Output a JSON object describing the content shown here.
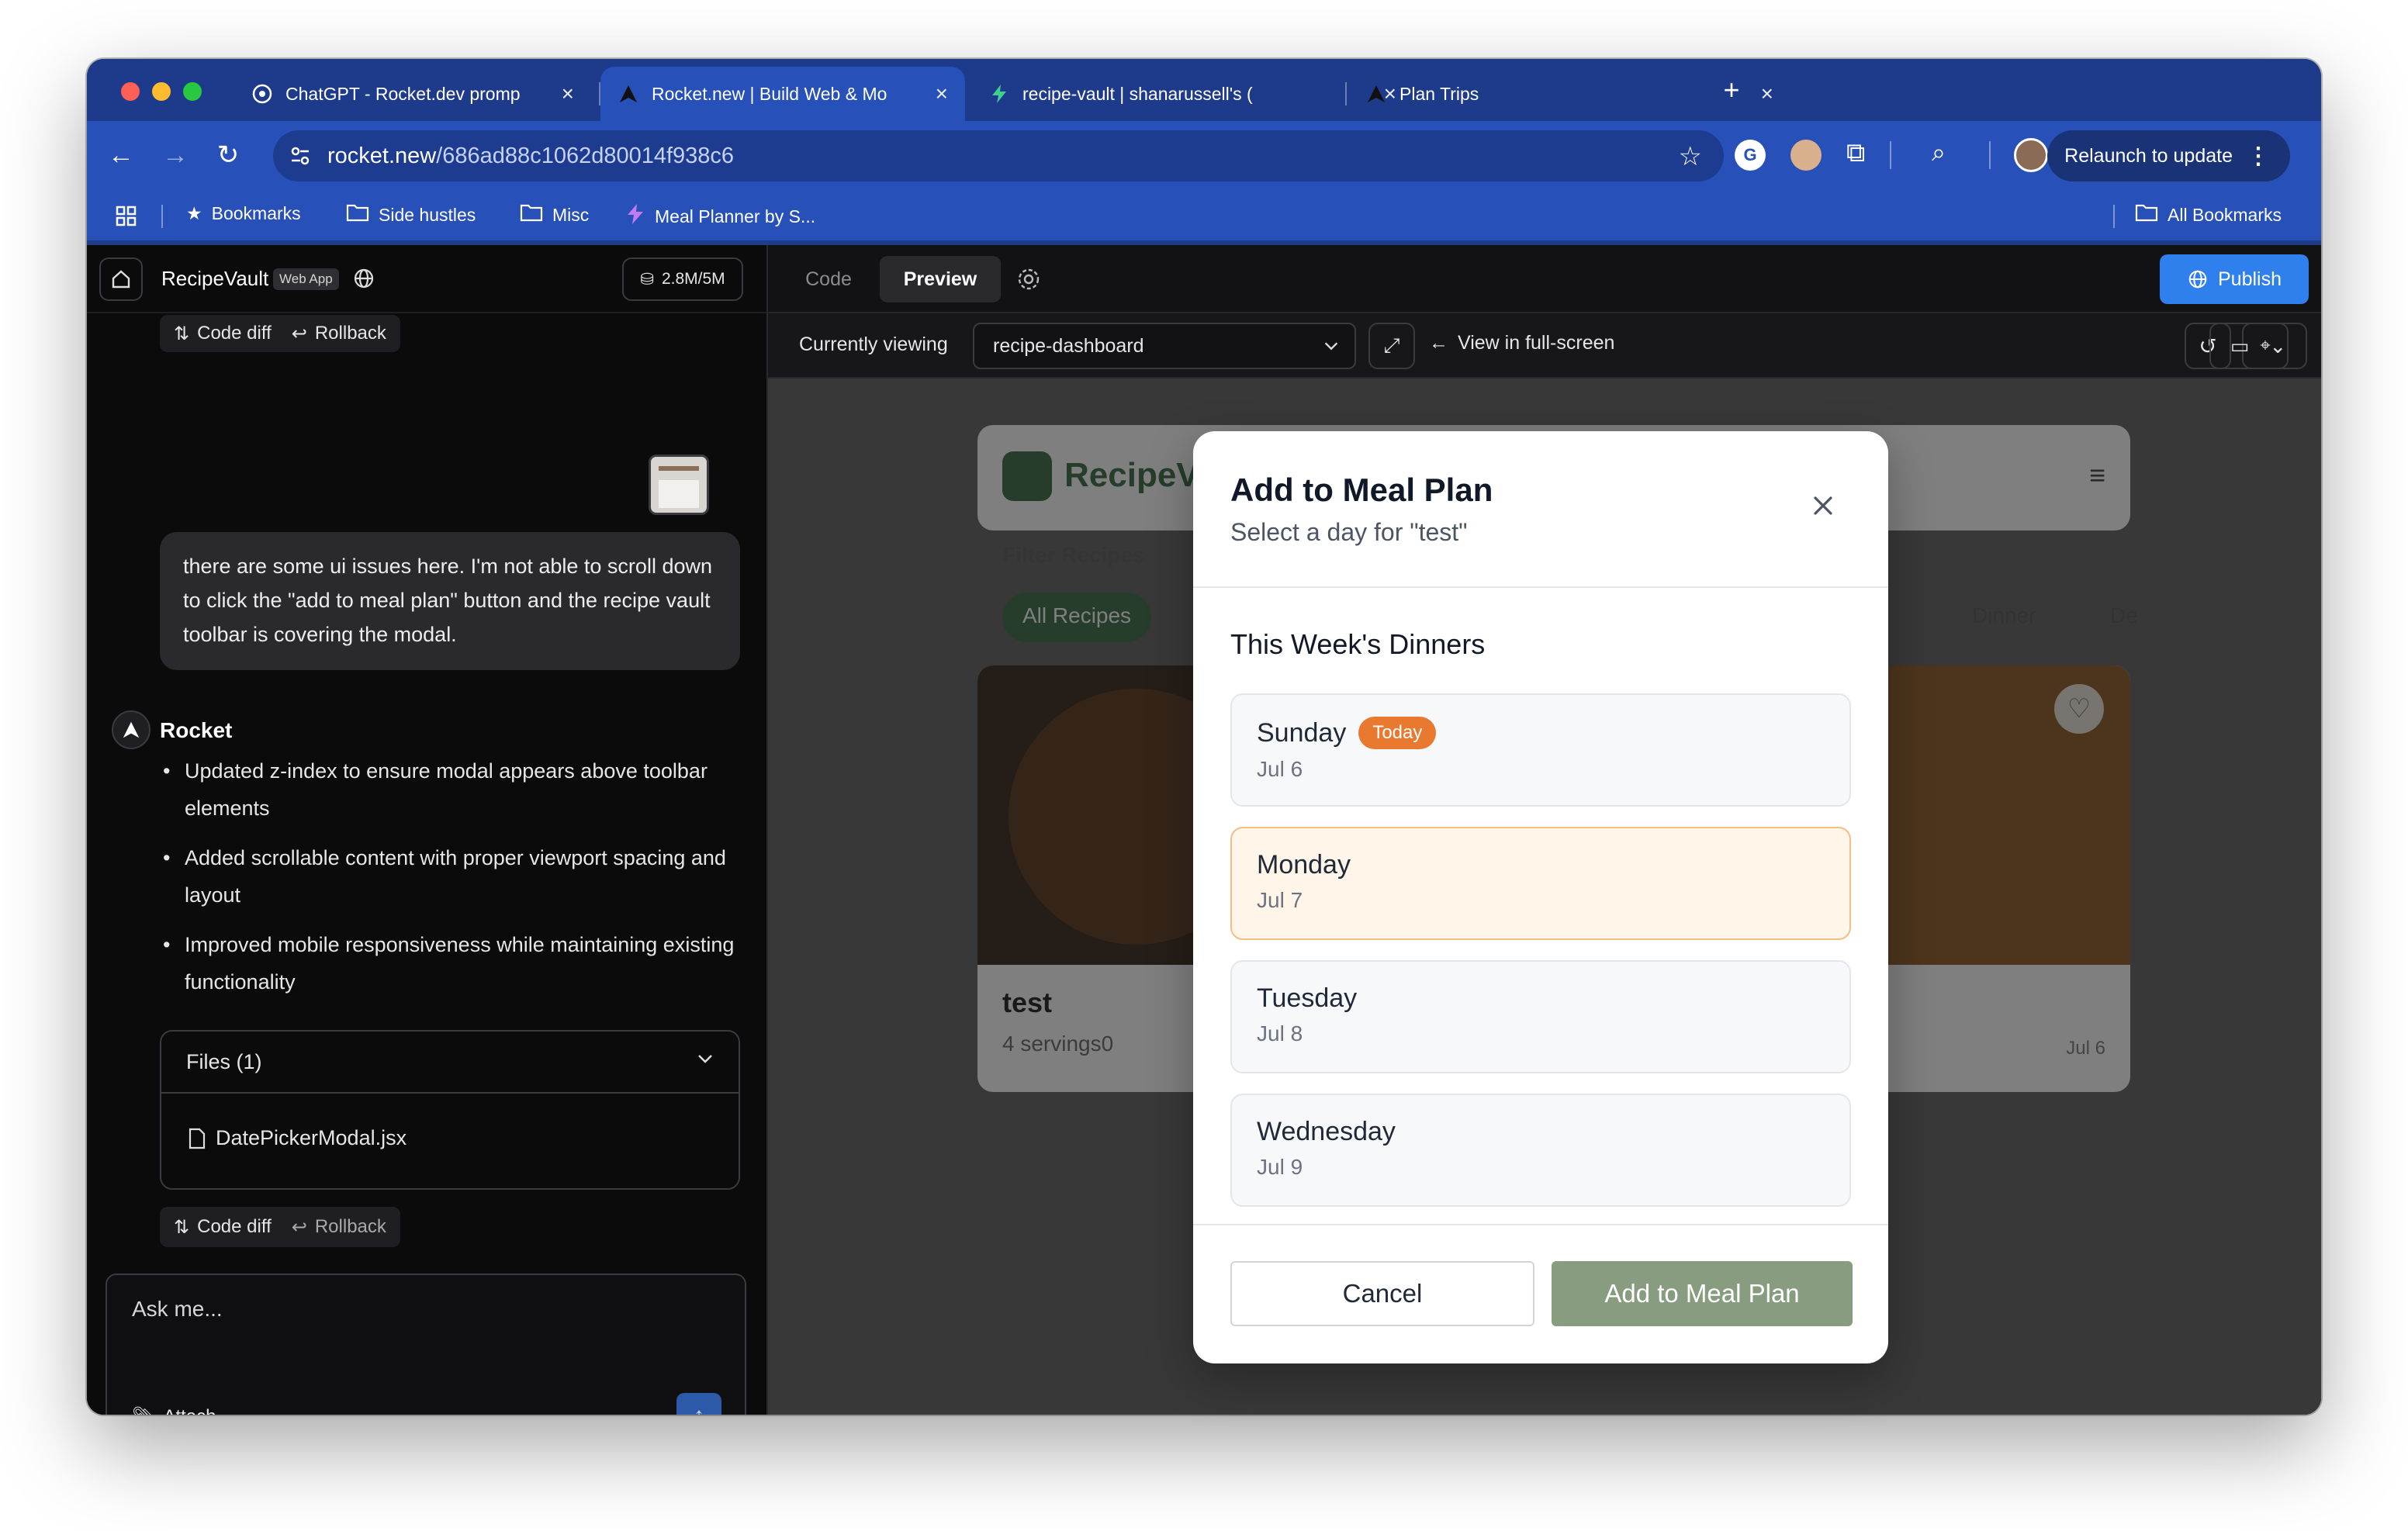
{
  "browser": {
    "tabs": [
      {
        "title": "ChatGPT - Rocket.dev promp",
        "favicon": "chatgpt-icon"
      },
      {
        "title": "Rocket.new | Build Web & Mo",
        "favicon": "rocket-icon",
        "active": true
      },
      {
        "title": "recipe-vault | shanarussell's (",
        "favicon": "bolt-icon"
      },
      {
        "title": "Plan Trips",
        "favicon": "rocket-icon"
      }
    ],
    "url_host": "rocket.new",
    "url_path": "/686ad88c1062d80014f938c6",
    "relaunch_label": "Relaunch to update",
    "bookmarks": [
      {
        "label": "Bookmarks",
        "icon": "star-icon"
      },
      {
        "label": "Side hustles",
        "icon": "folder-icon"
      },
      {
        "label": "Misc",
        "icon": "folder-icon"
      },
      {
        "label": "Meal Planner by S...",
        "icon": "bolt-icon"
      }
    ],
    "all_bookmarks_label": "All Bookmarks"
  },
  "left_panel": {
    "project_name": "RecipeVault",
    "project_badge": "Web App",
    "token_usage": "2.8M/5M",
    "code_diff_label": "Code diff",
    "rollback_label": "Rollback",
    "user_message": "there are some ui issues here. I'm not able to scroll down to click the \"add to meal plan\" button and the recipe vault toolbar is covering the modal.",
    "assistant_name": "Rocket",
    "assistant_bullets": [
      "Updated z-index to ensure modal appears above toolbar elements",
      "Added scrollable content with proper viewport spacing and layout",
      "Improved mobile responsiveness while maintaining existing functionality"
    ],
    "files_label": "Files (1)",
    "file_name": "DatePickerModal.jsx",
    "input_placeholder": "Ask me...",
    "attach_label": "Attach"
  },
  "right_panel": {
    "tabs": [
      "Code",
      "Preview"
    ],
    "active_tab": "Preview",
    "publish_label": "Publish",
    "currently_viewing_label": "Currently viewing",
    "viewing_value": "recipe-dashboard",
    "fullscreen_label": "View in full-screen"
  },
  "app_preview": {
    "brand": "RecipeVa",
    "filter_label": "Filter Recipes",
    "all_recipes_label": "All Recipes",
    "dinner_label": "Dinner",
    "dessert_label": "De",
    "card_title": "test",
    "card_servings": "4 servings0",
    "card_date": "Jul 6"
  },
  "modal": {
    "title": "Add to Meal Plan",
    "subtitle": "Select a day for \"test\"",
    "section_title": "This Week's Dinners",
    "today_badge": "Today",
    "days": [
      {
        "name": "Sunday",
        "date": "Jul 6"
      },
      {
        "name": "Monday",
        "date": "Jul 7"
      },
      {
        "name": "Tuesday",
        "date": "Jul 8"
      },
      {
        "name": "Wednesday",
        "date": "Jul 9"
      }
    ],
    "cancel_label": "Cancel",
    "confirm_label": "Add to Meal Plan",
    "accent_color": "#e8792f",
    "confirm_color": "#889d80"
  }
}
